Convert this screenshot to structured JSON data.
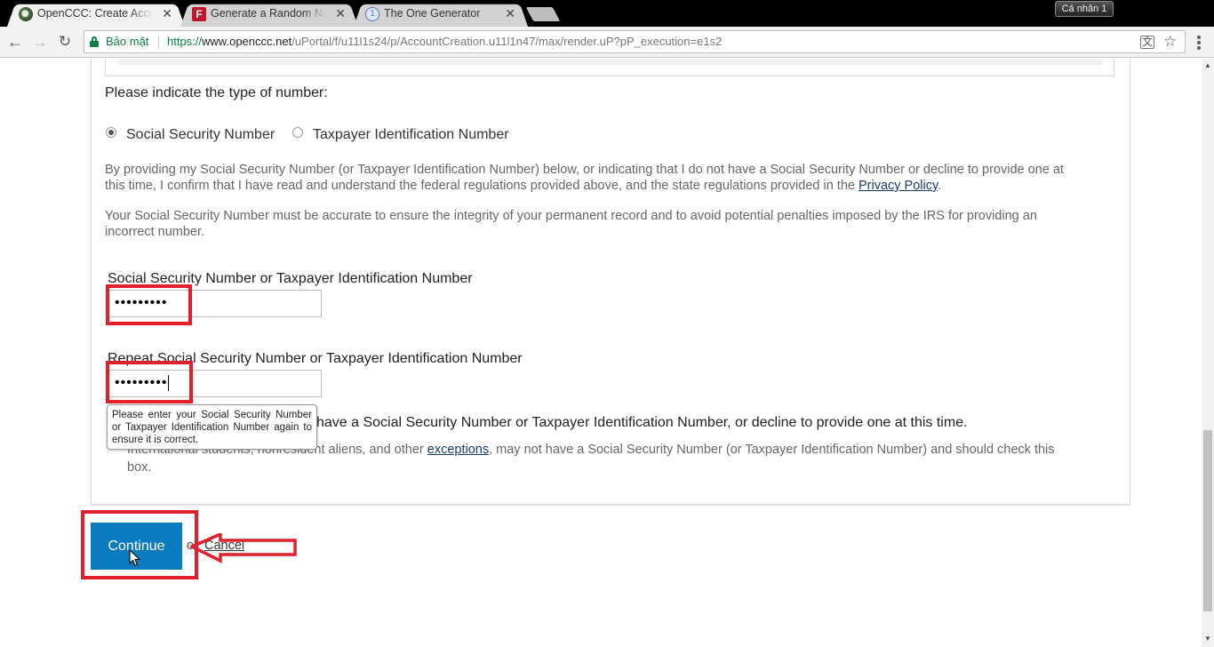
{
  "browser": {
    "tabs": [
      {
        "title": "OpenCCC: Create Account",
        "active": true
      },
      {
        "title": "Generate a Random Name",
        "active": false
      },
      {
        "title": "The One Generator",
        "active": false
      }
    ],
    "profile_label": "Cá nhân 1",
    "secure_label": "Bảo mật",
    "url_scheme": "https://",
    "url_host": "www.openccc.net",
    "url_path": "/uPortal/f/u11l1s24/p/AccountCreation.u11l1n47/max/render.uP?pP_execution=e1s2"
  },
  "form": {
    "number_type_question": "Please indicate the type of number:",
    "option_ssn": "Social Security Number",
    "option_tin": "Taxpayer Identification Number",
    "consent_text": "By providing my Social Security Number (or Taxpayer Identification Number) below, or indicating that I do not have a Social Security Number or decline to provide one at this time, I confirm that I have read and understand the federal regulations provided above, and the state regulations provided in the",
    "privacy_link": "Privacy Policy",
    "accuracy_text": "Your Social Security Number must be accurate to ensure the integrity of your permanent record and to avoid potential penalties imposed by the IRS for providing an incorrect number.",
    "ssn_label": "Social Security Number or Taxpayer Identification Number",
    "ssn_value": "•••••••••",
    "repeat_label": "Repeat Social Security Number or Taxpayer Identification Number",
    "repeat_value": "•••••••••",
    "tooltip": "Please enter your Social Security Number or Taxpayer Identification Number again to ensure it is correct.",
    "decline_visible": "have a Social Security Number or Taxpayer Identification Number, or decline to provide one at this time.",
    "exceptions_prefix": "International students, nonresident aliens, and other",
    "exceptions_link": "exceptions",
    "exceptions_suffix": ", may not have a Social Security Number (or Taxpayer Identification Number) and should check this box."
  },
  "actions": {
    "continue_label": "Continue",
    "or_label": "or",
    "cancel_label": "Cancel"
  },
  "colors": {
    "annotation": "#e0202a",
    "continue_bg": "#0a7bbf",
    "secure_green": "#0b8043"
  }
}
